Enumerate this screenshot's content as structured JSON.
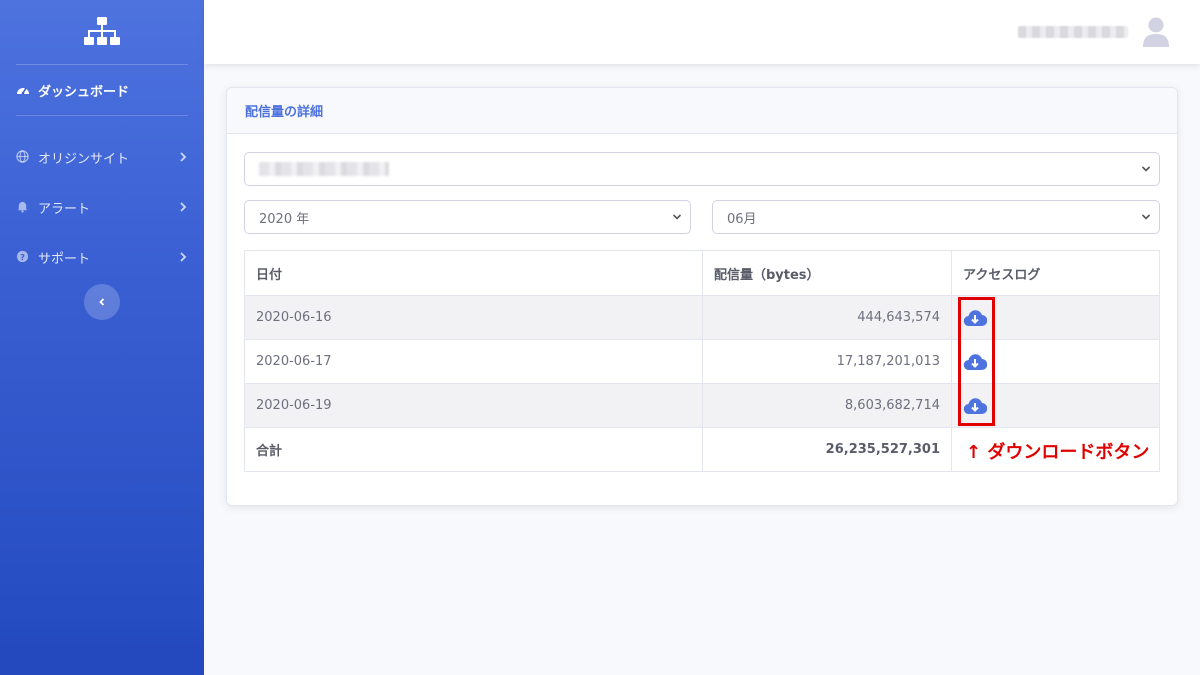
{
  "sidebar": {
    "brand_icon": "sitemap-icon",
    "items": [
      {
        "label": "ダッシュボード",
        "icon": "tachometer-icon",
        "active": true
      },
      {
        "label": "オリジンサイト",
        "icon": "globe-icon"
      },
      {
        "label": "アラート",
        "icon": "bell-icon"
      },
      {
        "label": "サポート",
        "icon": "question-circle-icon"
      }
    ],
    "toggle_icon": "chevron-left-icon"
  },
  "topbar": {
    "avatar_icon": "user-icon"
  },
  "card": {
    "title": "配信量の詳細",
    "year_select": "2020 年",
    "month_select": "06月"
  },
  "table": {
    "headers": [
      "日付",
      "配信量（bytes）",
      "アクセスログ"
    ],
    "rows": [
      {
        "date": "2020-06-16",
        "bytes": "444,643,574"
      },
      {
        "date": "2020-06-17",
        "bytes": "17,187,201,013"
      },
      {
        "date": "2020-06-19",
        "bytes": "8,603,682,714"
      }
    ],
    "total": {
      "label": "合計",
      "bytes": "26,235,527,301"
    }
  },
  "annotation": {
    "text": "↑ ダウンロードボタン",
    "color": "#e00000"
  },
  "colors": {
    "primary": "#4e73df",
    "sidebar_dark": "#224abe"
  }
}
